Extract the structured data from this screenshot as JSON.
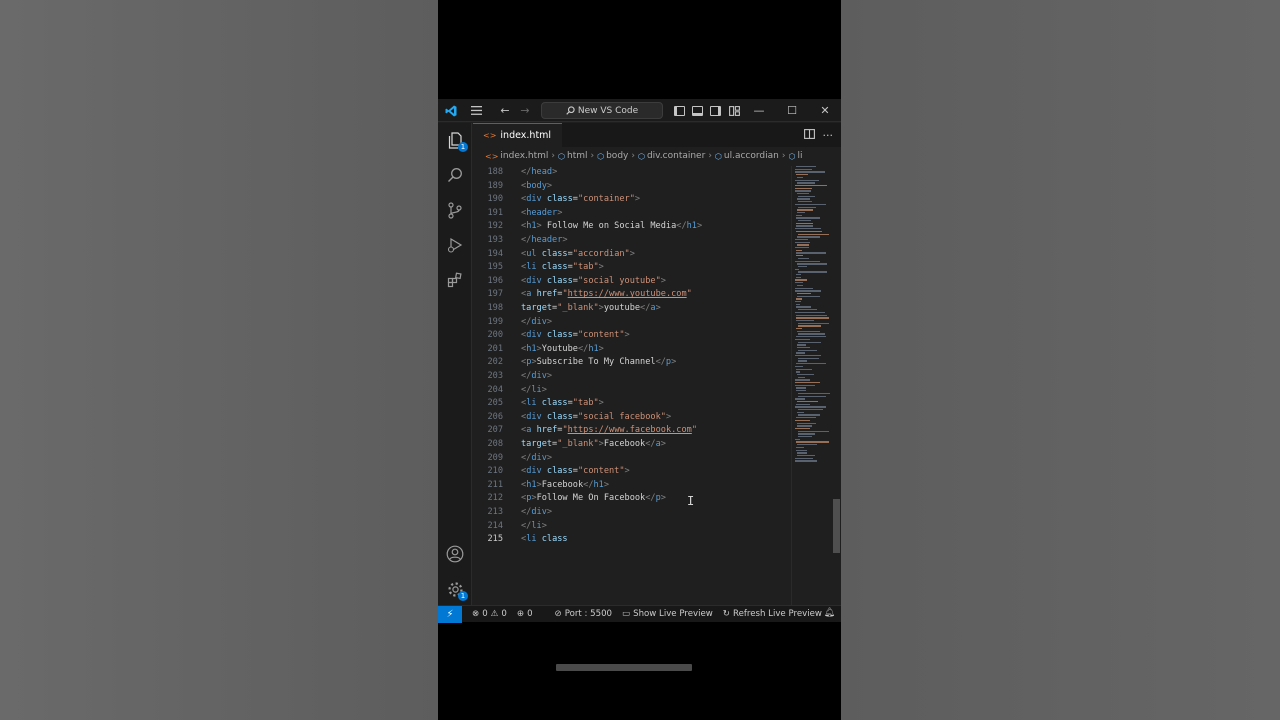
{
  "titlebar": {
    "search_label": "New VS Code",
    "menu_icon": "hamburger-menu-icon",
    "back_arrow": "←",
    "forward_arrow": "→",
    "minimize": "—",
    "maximize": "☐",
    "close": "✕"
  },
  "activity": {
    "explorer_badge": "1",
    "settings_badge": "1"
  },
  "tab": {
    "filename": "index.html"
  },
  "breadcrumb": [
    "index.html",
    "html",
    "body",
    "div.container",
    "ul.accordian",
    "li"
  ],
  "editor": {
    "active_line": 215,
    "lines": [
      {
        "n": "188"
      },
      {
        "n": "189"
      },
      {
        "n": "190"
      },
      {
        "n": "191"
      },
      {
        "n": "192"
      },
      {
        "n": "193"
      },
      {
        "n": "194"
      },
      {
        "n": "195"
      },
      {
        "n": "196"
      },
      {
        "n": "197"
      },
      {
        "n": "198"
      },
      {
        "n": "199"
      },
      {
        "n": "200"
      },
      {
        "n": "201"
      },
      {
        "n": "202"
      },
      {
        "n": "203"
      },
      {
        "n": "204"
      },
      {
        "n": "205"
      },
      {
        "n": "206"
      },
      {
        "n": "207"
      },
      {
        "n": "208"
      },
      {
        "n": "209"
      },
      {
        "n": "210"
      },
      {
        "n": "211"
      },
      {
        "n": "212"
      },
      {
        "n": "213"
      },
      {
        "n": "214"
      },
      {
        "n": "215"
      }
    ],
    "text": {
      "head": "head",
      "body": "body",
      "div": "div",
      "class": "class",
      "container": "\"container\"",
      "header": "header",
      "h1": "h1",
      "follow_social": " Follow Me on Social Media",
      "ul": "ul",
      "accordian": "\"accordian\"",
      "li": "li",
      "tab": "\"tab\"",
      "social_youtube": "\"social youtube\"",
      "a": "a",
      "href": "href",
      "eq": "=",
      "youtube_url": "https://www.youtube.com",
      "target": "target",
      "blank": "\"_blank\"",
      "youtube": "youtube",
      "content": "\"content\"",
      "Youtube": "Youtube",
      "p": "p",
      "subscribe": "Subscribe To My Channel",
      "social_facebook": "\"social facebook\"",
      "facebook_url": "https://www.facebook.com",
      "Facebook": "Facebook",
      "follow_facebook": "Follow Me On Facebook",
      "quote": "\""
    }
  },
  "statusbar": {
    "errors": "0",
    "warnings": "0",
    "ports": "0",
    "port": "Port : 5500",
    "show_live": "Show Live Preview",
    "refresh_live": "Refresh Live Preview"
  },
  "colors": {
    "accent": "#0078d4",
    "tag": "#569cd6",
    "attr": "#9cdcfe",
    "string": "#ce9178",
    "text": "#d4d4d4"
  }
}
